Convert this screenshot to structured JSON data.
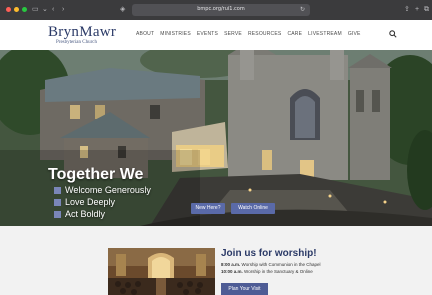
{
  "browser": {
    "url": "bmpc.org/rui1.com",
    "icons": [
      "back-icon",
      "forward-icon",
      "sidebar-icon",
      "shield-icon",
      "reload-icon",
      "share-icon",
      "new-tab-icon",
      "tabs-icon"
    ]
  },
  "header": {
    "logo_main": "BrynMawr",
    "logo_sub": "Presbyterian Church",
    "nav": [
      "ABOUT",
      "MINISTRIES",
      "EVENTS",
      "SERVE",
      "RESOURCES",
      "CARE",
      "LIVESTREAM",
      "GIVE"
    ]
  },
  "hero": {
    "title": "Together We",
    "bullets": [
      "Welcome Generously",
      "Love Deeply",
      "Act Boldly"
    ],
    "new_here_label": "New Here?",
    "watch_label": "Watch Online"
  },
  "worship": {
    "title": "Join us for worship!",
    "line1_time": "8:00 a.m.",
    "line1_text": "Worship with Communion in the Chapel",
    "line2_time": "10:00 a.m.",
    "line2_text": "Worship in the Sanctuary & Online",
    "plan_label": "Plan Your Visit"
  },
  "colors": {
    "brand_navy": "#2b3a67",
    "button_blue": "#5a6aa8",
    "bullet_blue": "#7a86b8"
  }
}
